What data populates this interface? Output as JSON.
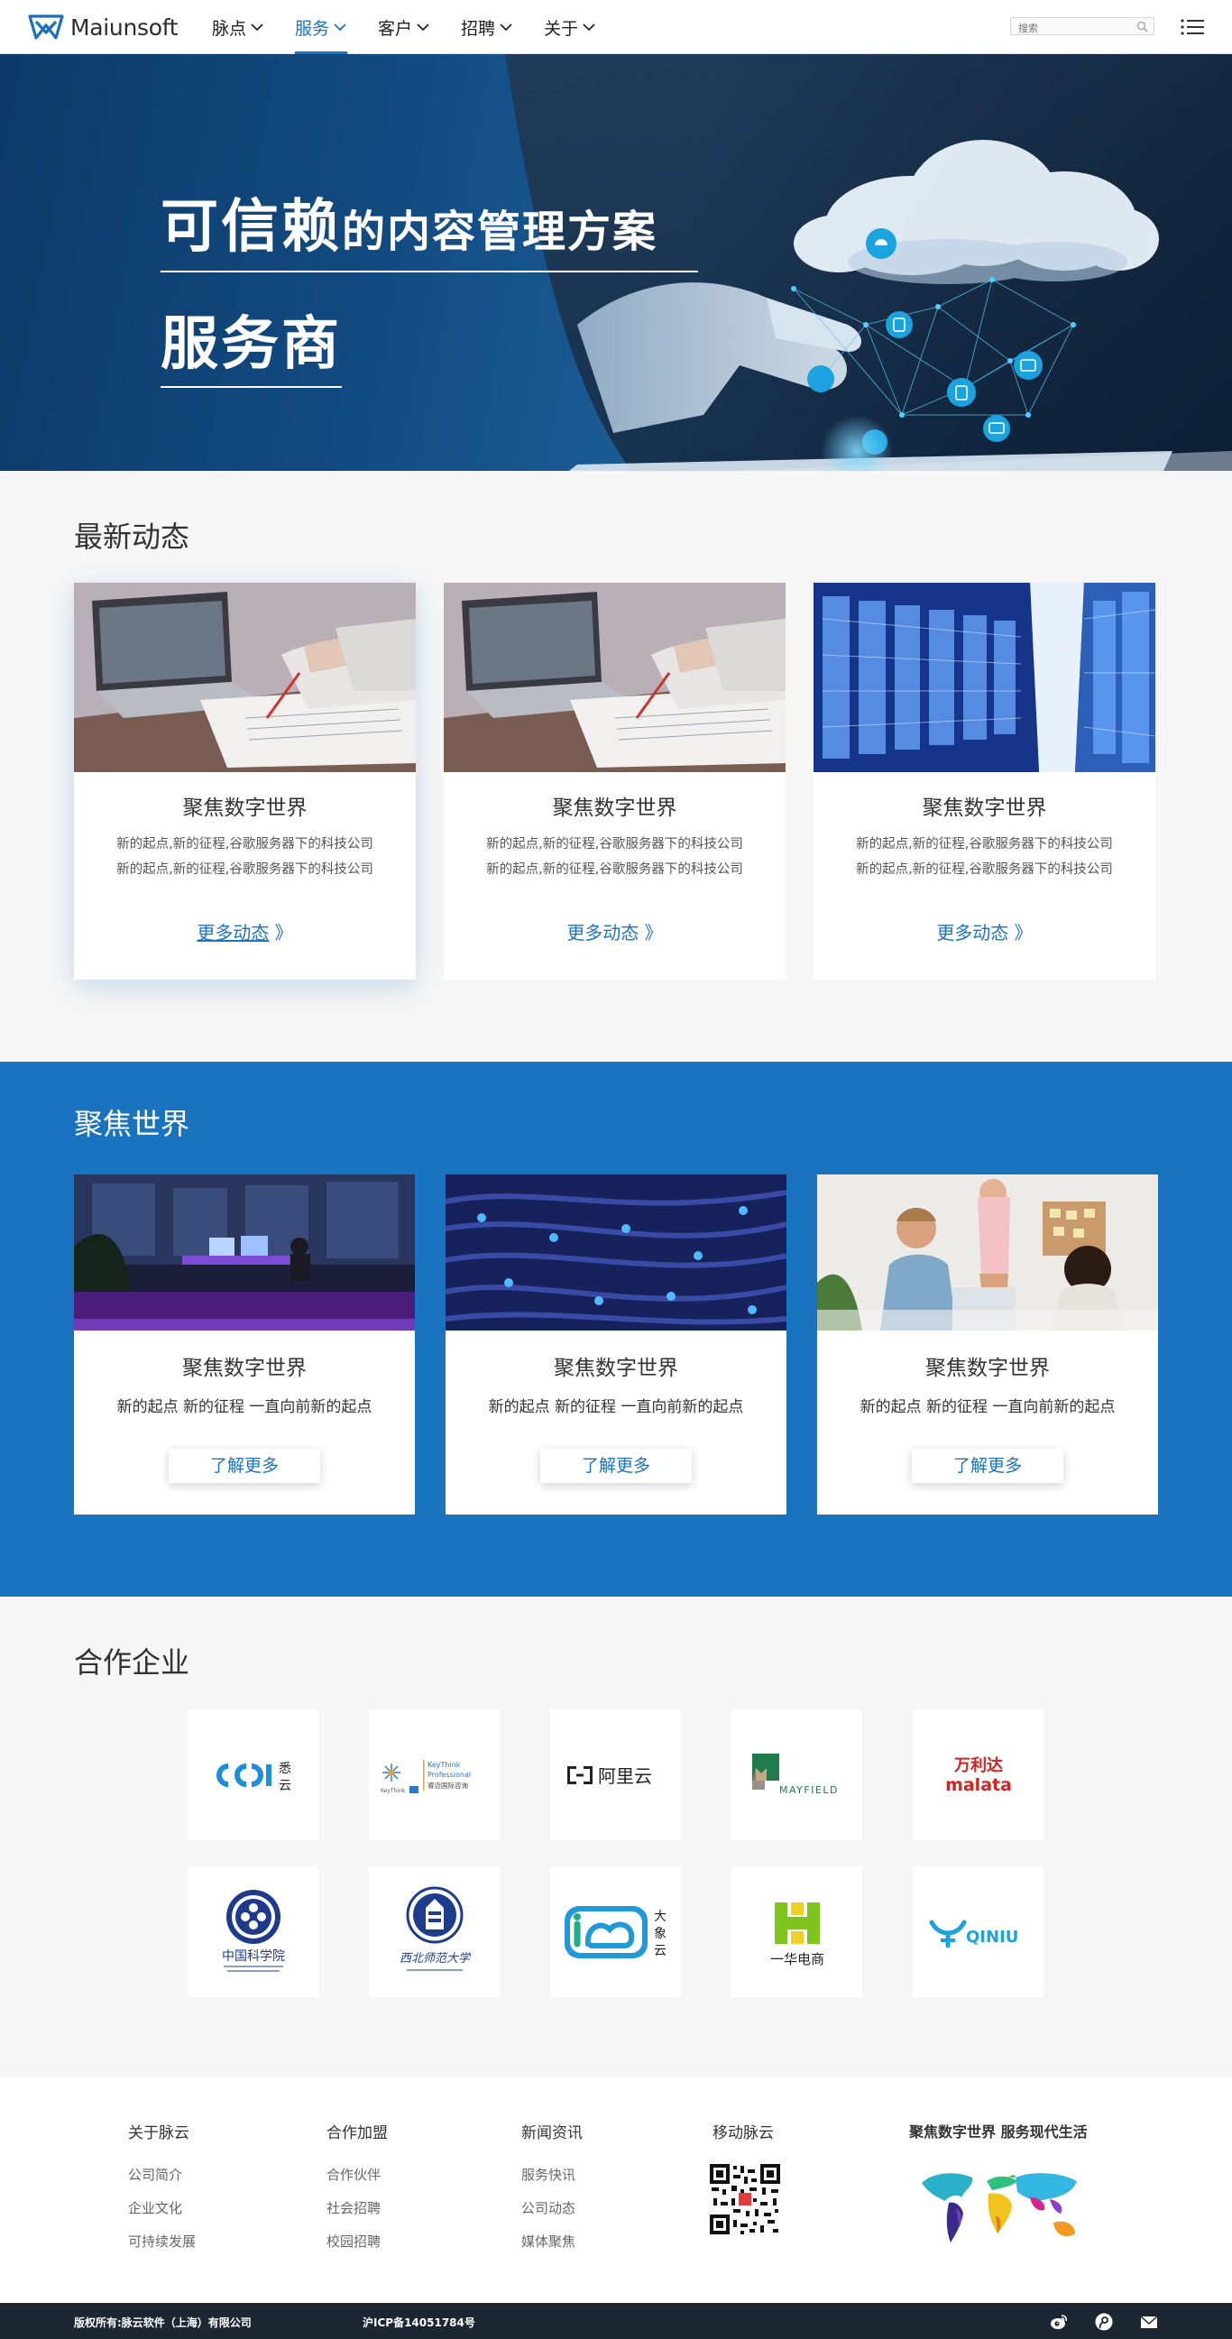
{
  "header": {
    "logo_text": "Maiunsoft",
    "nav": [
      {
        "label": "脉点",
        "active": false
      },
      {
        "label": "服务",
        "active": true
      },
      {
        "label": "客户",
        "active": false
      },
      {
        "label": "招聘",
        "active": false
      },
      {
        "label": "关于",
        "active": false
      }
    ],
    "search_placeholder": "搜索"
  },
  "hero": {
    "title_big": "可信赖",
    "title_rest": "的内容管理方案",
    "title_line2": "服务商"
  },
  "news": {
    "title": "最新动态",
    "cards": [
      {
        "heading": "聚焦数字世界",
        "line1": "新的起点,新的征程,谷歌服务器下的科技公司",
        "line2": "新的起点,新的征程,谷歌服务器下的科技公司",
        "more": "更多动态",
        "arrow": "》",
        "image": "laptop-desk-photo"
      },
      {
        "heading": "聚焦数字世界",
        "line1": "新的起点,新的征程,谷歌服务器下的科技公司",
        "line2": "新的起点,新的征程,谷歌服务器下的科技公司",
        "more": "更多动态",
        "arrow": "》",
        "image": "laptop-desk-photo"
      },
      {
        "heading": "聚焦数字世界",
        "line1": "新的起点,新的征程,谷歌服务器下的科技公司",
        "line2": "新的起点,新的征程,谷歌服务器下的科技公司",
        "more": "更多动态",
        "arrow": "》",
        "image": "server-room-photo"
      }
    ]
  },
  "focus": {
    "title": "聚焦世界",
    "cards": [
      {
        "heading": "聚焦数字世界",
        "text": "新的起点 新的征程 一直向前新的起点",
        "button": "了解更多",
        "image": "night-office-photo"
      },
      {
        "heading": "聚焦数字世界",
        "text": "新的起点 新的征程 一直向前新的起点",
        "button": "了解更多",
        "image": "network-cables-photo"
      },
      {
        "heading": "聚焦数字世界",
        "text": "新的起点 新的征程 一直向前新的起点",
        "button": "了解更多",
        "image": "team-meeting-photo"
      }
    ]
  },
  "partners": {
    "title": "合作企业",
    "logos": [
      {
        "name": "悉云",
        "text": "悉云"
      },
      {
        "name": "KeyThink Professional",
        "text": "KeyThink Professional",
        "sub": "睿迈国际咨询"
      },
      {
        "name": "阿里云",
        "text": "阿里云"
      },
      {
        "name": "MAYFIELD",
        "text": "MAYFIELD"
      },
      {
        "name": "万利达 malata",
        "text": "万利达",
        "sub": "malata"
      },
      {
        "name": "中国科学院",
        "text": "中国科学院"
      },
      {
        "name": "西北师范大学",
        "text": "西北师范大学"
      },
      {
        "name": "大象云",
        "text": "大象云"
      },
      {
        "name": "一华电商",
        "text": "一华电商"
      },
      {
        "name": "QINIU",
        "text": "QINIU"
      }
    ]
  },
  "footer": {
    "cols": [
      {
        "title": "关于脉云",
        "links": [
          "公司简介",
          "企业文化",
          "可持续发展"
        ]
      },
      {
        "title": "合作加盟",
        "links": [
          "合作伙伴",
          "社会招聘",
          "校园招聘"
        ]
      },
      {
        "title": "新闻资讯",
        "links": [
          "服务快讯",
          "公司动态",
          "媒体聚焦"
        ]
      }
    ],
    "mobile_title": "移动脉云",
    "slogan": "聚焦数字世界  服务现代生活",
    "copyright": "版权所有:脉云软件（上海）有限公司",
    "icp": "沪ICP备14051784号"
  },
  "colors": {
    "brand_blue": "#1a73c4",
    "focus_bg": "#1a73be",
    "bottom_bar": "#1d2733"
  }
}
